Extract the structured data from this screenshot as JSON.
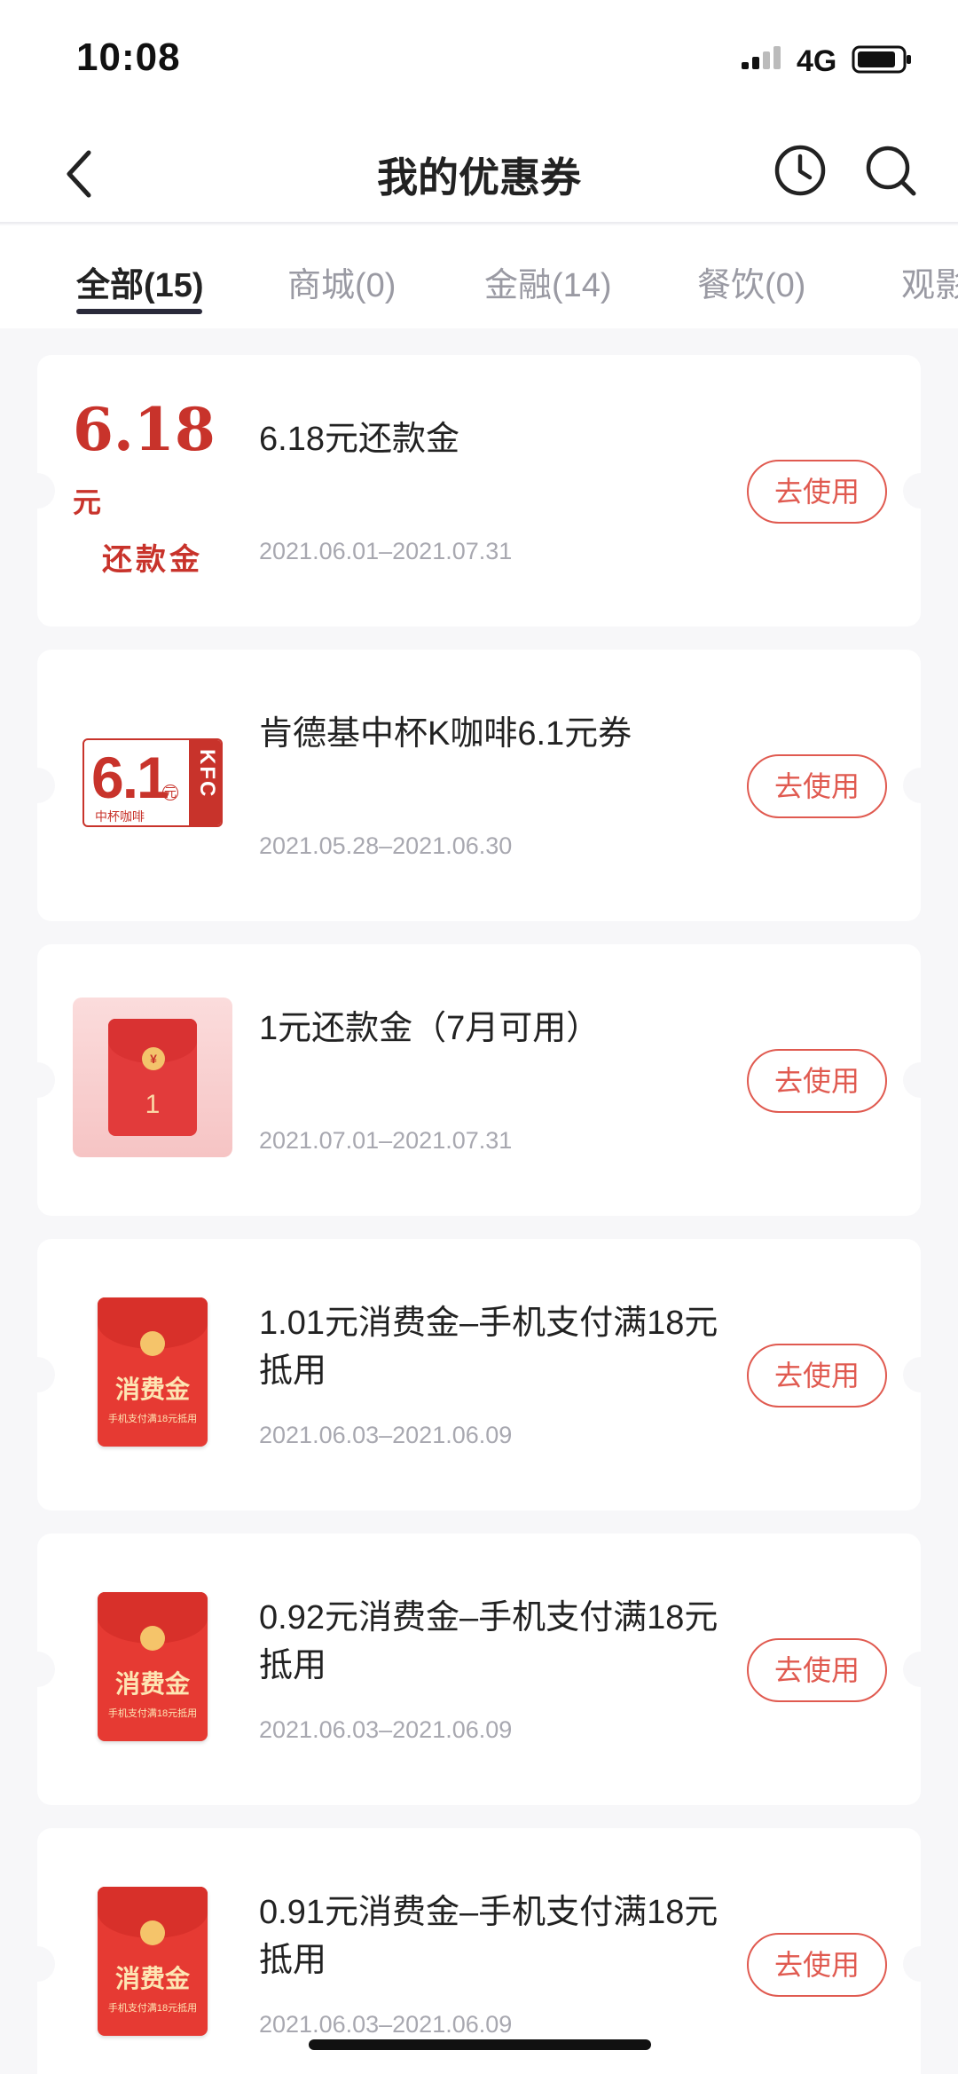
{
  "status_bar": {
    "time": "10:08",
    "network": "4G"
  },
  "nav": {
    "title": "我的优惠券"
  },
  "tabs": [
    {
      "label": "全部(15)",
      "active": true
    },
    {
      "label": "商城(0)"
    },
    {
      "label": "金融(14)"
    },
    {
      "label": "餐饮(0)"
    },
    {
      "label": "观影"
    }
  ],
  "coupons": [
    {
      "title": "6.18元还款金",
      "date_range": "2021.06.01–2021.07.31",
      "button": "去使用",
      "thumb": {
        "amount": "6.18",
        "unit": "元",
        "caption": "还款金"
      }
    },
    {
      "title": "肯德基中杯K咖啡6.1元券",
      "date_range": "2021.05.28–2021.06.30",
      "button": "去使用",
      "thumb": {
        "amount": "6.1",
        "unit": "元",
        "caption": "中杯咖啡",
        "brand": "KFC"
      }
    },
    {
      "title": "1元还款金（7月可用）",
      "date_range": "2021.07.01–2021.07.31",
      "button": "去使用",
      "thumb": {
        "coin": "¥",
        "amount": "1"
      }
    },
    {
      "title": "1.01元消费金–手机支付满18元抵用",
      "date_range": "2021.06.03–2021.06.09",
      "button": "去使用",
      "thumb": {
        "label": "消费金",
        "fine": "手机支付满18元抵用"
      }
    },
    {
      "title": "0.92元消费金–手机支付满18元抵用",
      "date_range": "2021.06.03–2021.06.09",
      "button": "去使用",
      "thumb": {
        "label": "消费金",
        "fine": "手机支付满18元抵用"
      }
    },
    {
      "title": "0.91元消费金–手机支付满18元抵用",
      "date_range": "2021.06.03–2021.06.09",
      "button": "去使用",
      "thumb": {
        "label": "消费金",
        "fine": "手机支付满18元抵用"
      }
    }
  ],
  "colors": {
    "accent": "#e05a50",
    "tab_active": "#222222",
    "tab_inactive": "#9a9aa3",
    "background": "#f7f7f9"
  },
  "icons": [
    "back-icon",
    "history-clock-icon",
    "search-icon",
    "signal-icon",
    "battery-icon"
  ]
}
